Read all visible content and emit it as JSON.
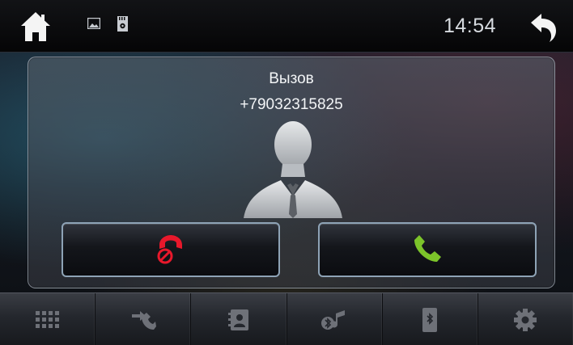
{
  "status_bar": {
    "time": "14:54",
    "icons": [
      "home-icon",
      "picture-icon",
      "sd-card-icon",
      "back-arrow-icon"
    ]
  },
  "call_dialog": {
    "label": "Вызов",
    "number": "+79032315825",
    "avatar_icon": "person-silhouette-icon",
    "reject_icon": "hang-up-phone-icon",
    "answer_icon": "answer-phone-icon",
    "colors": {
      "reject": "#e8182b",
      "answer": "#7cc42a"
    }
  },
  "toolbar": {
    "items": [
      {
        "icon": "dialpad-icon"
      },
      {
        "icon": "call-transfer-icon"
      },
      {
        "icon": "contacts-icon"
      },
      {
        "icon": "bluetooth-music-icon"
      },
      {
        "icon": "bluetooth-phone-icon"
      },
      {
        "icon": "settings-gear-icon"
      }
    ]
  }
}
